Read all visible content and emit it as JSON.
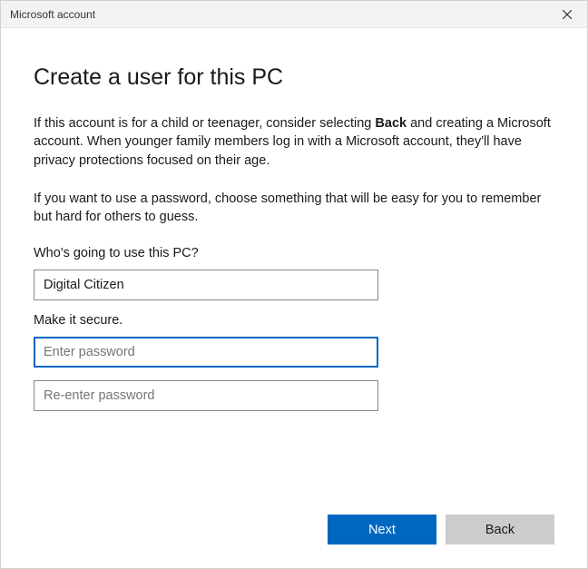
{
  "titlebar": {
    "title": "Microsoft account"
  },
  "main": {
    "heading": "Create a user for this PC",
    "para1_pre": "If this account is for a child or teenager, consider selecting ",
    "para1_bold": "Back",
    "para1_post": " and creating a Microsoft account. When younger family members log in with a Microsoft account, they'll have privacy protections focused on their age.",
    "para2": "If you want to use a password, choose something that will be easy for you to remember but hard for others to guess.",
    "username_label": "Who's going to use this PC?",
    "username_value": "Digital Citizen",
    "secure_label": "Make it secure.",
    "password_placeholder": "Enter password",
    "password_value": "",
    "password2_placeholder": "Re-enter password",
    "password2_value": ""
  },
  "footer": {
    "next_label": "Next",
    "back_label": "Back"
  }
}
